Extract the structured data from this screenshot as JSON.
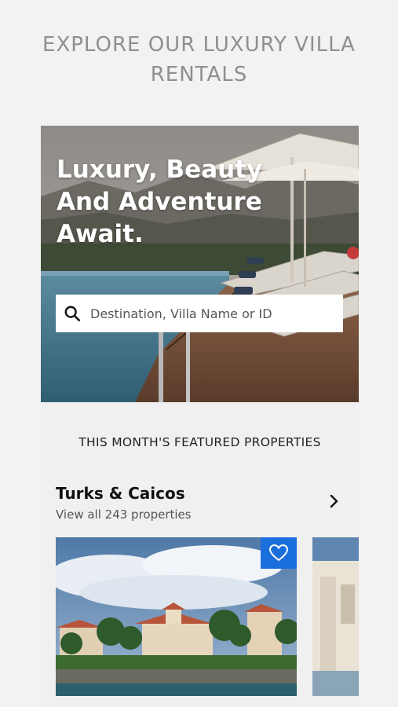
{
  "page": {
    "heading": "EXPLORE OUR LUXURY VILLA RENTALS"
  },
  "hero": {
    "title": "Luxury, Beauty And Adventure Await.",
    "search": {
      "placeholder": "Destination, Villa Name or ID",
      "value": "",
      "icon": "search-icon"
    }
  },
  "featured": {
    "heading": "THIS MONTH'S FEATURED PROPERTIES",
    "region": {
      "name": "Turks & Caicos",
      "view_all": "View all 243 properties",
      "next_icon": "chevron-right-icon"
    },
    "cards": [
      {
        "favorite_icon": "heart-icon",
        "favorite_color": "#1b6fdc"
      },
      {}
    ]
  },
  "colors": {
    "background": "#f2f2f2",
    "heading_gray": "#8f8f8f",
    "accent_blue": "#1b6fdc"
  }
}
